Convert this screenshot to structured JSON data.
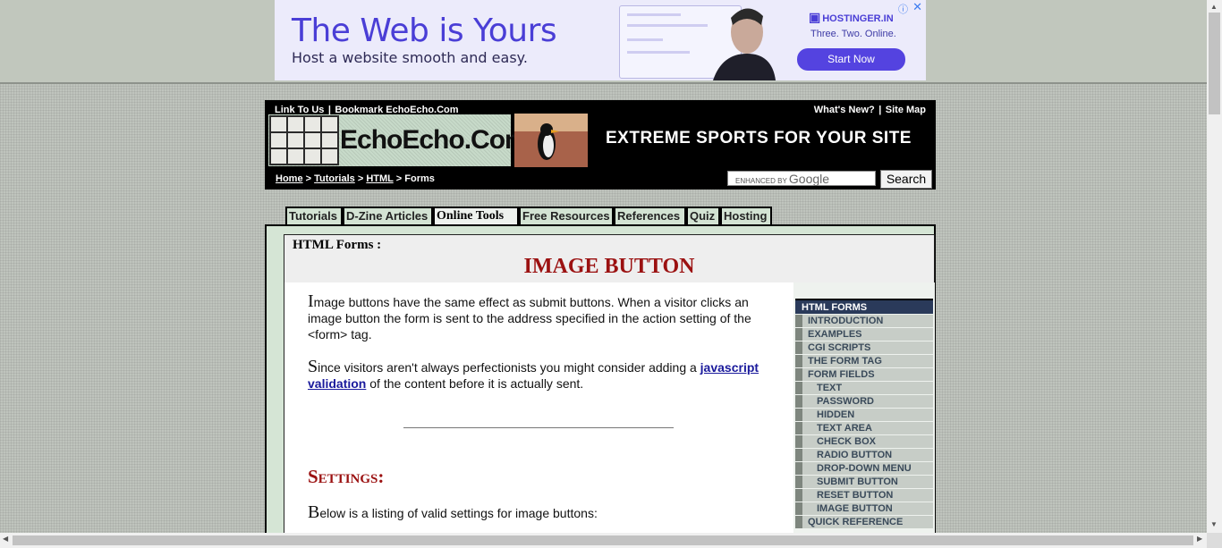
{
  "ad": {
    "headline": "The Web is Yours",
    "subline": "Host a website smooth and easy.",
    "brand": "HOSTINGER.IN",
    "tagline": "Three. Two. Online.",
    "cta": "Start Now",
    "info_icon": "ⓘ",
    "close_icon": "✕"
  },
  "header": {
    "left_links": [
      "Link To Us",
      "Bookmark EchoEcho.Com"
    ],
    "right_links": [
      "What's New?",
      "Site Map"
    ],
    "separator": "|",
    "logo_text": "EchoEcho.Com",
    "promo": "EXTREME SPORTS FOR YOUR SITE",
    "breadcrumb": [
      "Home",
      "Tutorials",
      "HTML",
      "Forms"
    ],
    "breadcrumb_sep": ">",
    "search_placeholder_prefix": "ENHANCED BY",
    "search_brand": "Google",
    "search_button": "Search"
  },
  "tabs": [
    "Tutorials",
    "D-Zine Articles",
    "Online Tools",
    "Free Resources",
    "References",
    "Quiz",
    "Hosting"
  ],
  "active_tab": "Online Tools",
  "page": {
    "subtitle": "HTML Forms :",
    "title": "IMAGE BUTTON",
    "para1_cap": "I",
    "para1": "mage buttons have the same effect as submit buttons. When a visitor clicks an image button the form is sent to the address specified in the action setting of the <form> tag.",
    "para2_cap": "S",
    "para2_a": "ince visitors aren't always perfectionists you might consider adding a ",
    "para2_link": "javascript validation",
    "para2_b": " of the content before it is actually sent.",
    "settings_heading": "Settings:",
    "para3_cap": "B",
    "para3": "elow is a listing of valid settings for image buttons:"
  },
  "sidebar": {
    "heading": "HTML FORMS",
    "items": [
      {
        "label": "INTRODUCTION",
        "sub": false
      },
      {
        "label": "EXAMPLES",
        "sub": false
      },
      {
        "label": "CGI SCRIPTS",
        "sub": false
      },
      {
        "label": "THE FORM TAG",
        "sub": false
      },
      {
        "label": "FORM FIELDS",
        "sub": false
      },
      {
        "label": "TEXT",
        "sub": true
      },
      {
        "label": "PASSWORD",
        "sub": true
      },
      {
        "label": "HIDDEN",
        "sub": true
      },
      {
        "label": "TEXT AREA",
        "sub": true
      },
      {
        "label": "CHECK BOX",
        "sub": true
      },
      {
        "label": "RADIO BUTTON",
        "sub": true
      },
      {
        "label": "DROP-DOWN MENU",
        "sub": true
      },
      {
        "label": "SUBMIT BUTTON",
        "sub": true
      },
      {
        "label": "RESET BUTTON",
        "sub": true
      },
      {
        "label": "IMAGE BUTTON",
        "sub": true
      },
      {
        "label": "QUICK REFERENCE",
        "sub": false
      }
    ]
  },
  "colors": {
    "accent_red": "#9b1111",
    "ad_purple": "#4a3ed6",
    "tab_green": "#d3e3d3"
  }
}
